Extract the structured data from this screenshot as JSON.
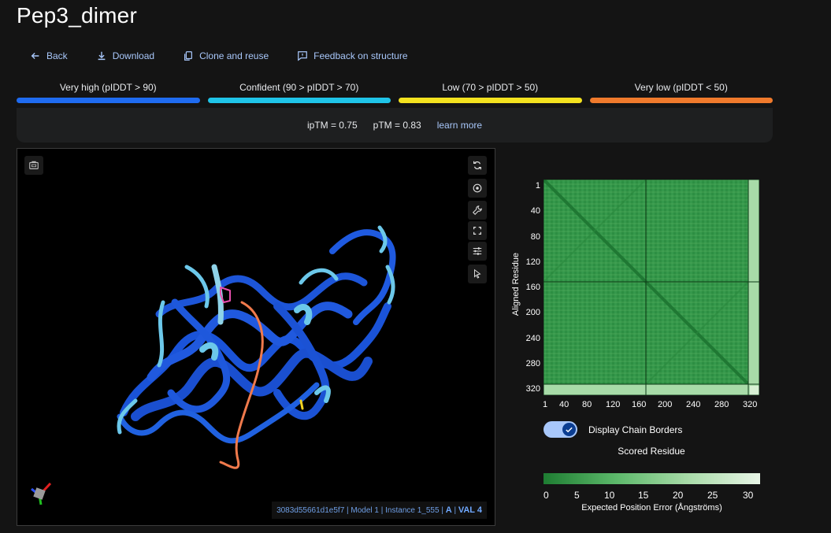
{
  "title": "Pep3_dimer",
  "actions": {
    "back": "Back",
    "download": "Download",
    "clone": "Clone and reuse",
    "feedback": "Feedback on structure"
  },
  "legend": [
    {
      "label": "Very high (pIDDT > 90)",
      "color": "#1f6bf0"
    },
    {
      "label": "Confident (90 > pIDDT > 70)",
      "color": "#1fc4e8"
    },
    {
      "label": "Low (70 > pIDDT > 50)",
      "color": "#f4e21f"
    },
    {
      "label": "Very low (pIDDT < 50)",
      "color": "#f07a2c"
    }
  ],
  "scores": {
    "iptm": "ipTM = 0.75",
    "ptm": "pTM = 0.83",
    "learn_more": "learn more"
  },
  "viewer": {
    "footer_meta": "3083d55661d1e5f7 | Model 1 | Instance 1_555 |",
    "chain": "A",
    "residue": "VAL 4"
  },
  "pae": {
    "y_ticks": [
      "1",
      "40",
      "80",
      "120",
      "160",
      "200",
      "240",
      "280",
      "320"
    ],
    "x_ticks": [
      "1",
      "40",
      "80",
      "120",
      "160",
      "200",
      "240",
      "280",
      "320"
    ],
    "ylabel": "Aligned Residue",
    "xlabel": "Scored Residue",
    "toggle_label": "Display Chain Borders",
    "colorbar_ticks": [
      "0",
      "5",
      "10",
      "15",
      "20",
      "25",
      "30"
    ],
    "colorbar_label": "Expected Position Error (Ångströms)"
  }
}
